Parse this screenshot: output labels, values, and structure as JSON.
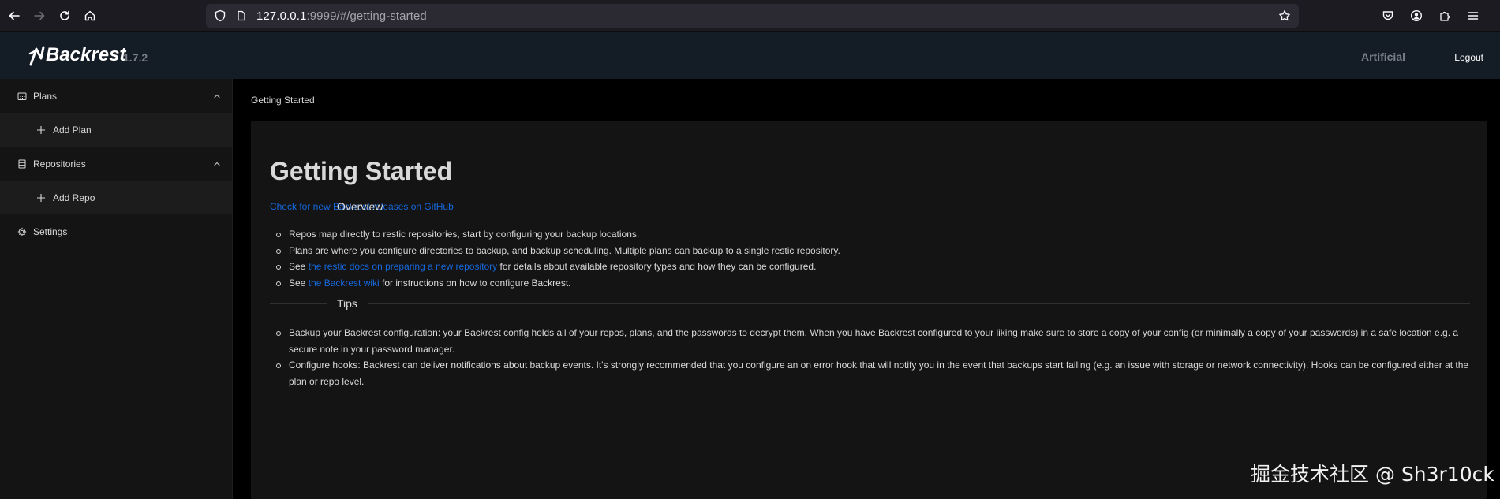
{
  "browser": {
    "url_host": "127.0.0.1",
    "url_rest": ":9999/#/getting-started"
  },
  "header": {
    "app_name": "Backrest",
    "version": "1.7.2",
    "user": "Artificial",
    "logout_label": "Logout"
  },
  "sidebar": {
    "plans_label": "Plans",
    "add_plan_label": "Add Plan",
    "repos_label": "Repositories",
    "add_repo_label": "Add Repo",
    "settings_label": "Settings"
  },
  "main": {
    "breadcrumb": "Getting Started",
    "title": "Getting Started",
    "github_link": "Check for new Backrest releases on GitHub",
    "overview_heading": "Overview",
    "overview_items": [
      "Repos map directly to restic repositories, start by configuring your backup locations.",
      "Plans are where you configure directories to backup, and backup scheduling. Multiple plans can backup to a single restic repository.",
      {
        "prefix": "See ",
        "link": "the restic docs on preparing a new repository",
        "suffix": " for details about available repository types and how they can be configured."
      },
      {
        "prefix": "See ",
        "link": "the Backrest wiki",
        "suffix": " for instructions on how to configure Backrest."
      }
    ],
    "tips_heading": "Tips",
    "tips_items": [
      "Backup your Backrest configuration: your Backrest config holds all of your repos, plans, and the passwords to decrypt them. When you have Backrest configured to your liking make sure to store a copy of your config (or minimally a copy of your passwords) in a safe location e.g. a secure note in your password manager.",
      "Configure hooks: Backrest can deliver notifications about backup events. It's strongly recommended that you configure an on error hook that will notify you in the event that backups start failing (e.g. an issue with storage or network connectivity). Hooks can be configured either at the plan or repo level."
    ]
  },
  "watermark": "掘金技术社区 @ Sh3r10ck"
}
